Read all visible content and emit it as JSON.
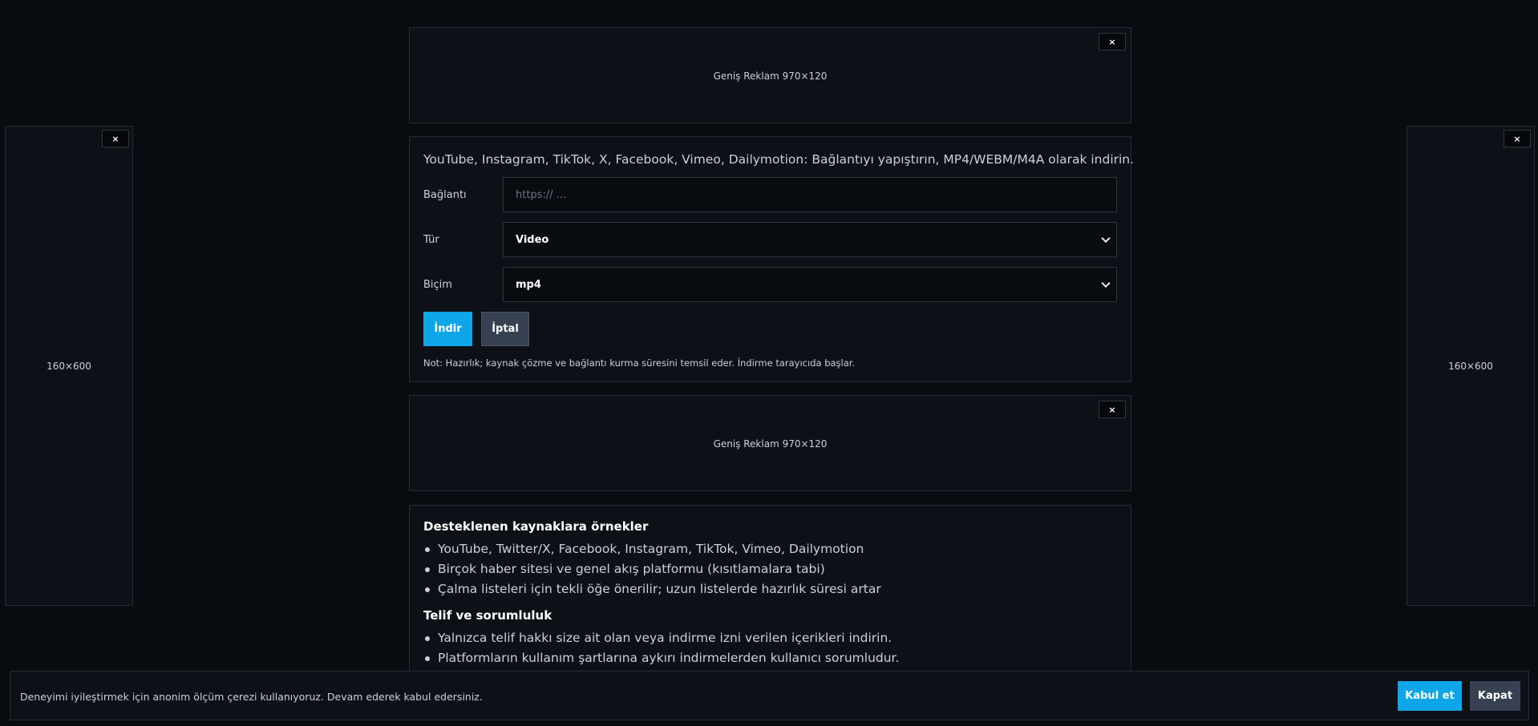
{
  "ads": {
    "side_left_label": "160×600",
    "side_right_label": "160×600",
    "banner_top_label": "Geniş Reklam 970×120",
    "banner_mid_label": "Geniş Reklam 970×120",
    "close_label": "×"
  },
  "form": {
    "headline": "YouTube, Instagram, TikTok, X, Facebook, Vimeo, Dailymotion: Bağlantıyı yapıştırın, MP4/WEBM/M4A olarak indirin.",
    "link_label": "Bağlantı",
    "link_placeholder": "https:// ...",
    "type_label": "Tür",
    "type_value": "Video",
    "format_label": "Biçim",
    "format_value": "mp4",
    "download_button": "İndir",
    "cancel_button": "İptal",
    "note": "Not: Hazırlık; kaynak çözme ve bağlantı kurma süresini temsil eder. İndirme tarayıcıda başlar."
  },
  "info": {
    "supported_title": "Desteklenen kaynaklara örnekler",
    "supported_items": [
      "YouTube, Twitter/X, Facebook, Instagram, TikTok, Vimeo, Dailymotion",
      "Birçok haber sitesi ve genel akış platformu (kısıtlamalara tabi)",
      "Çalma listeleri için tekli öğe önerilir; uzun listelerde hazırlık süresi artar"
    ],
    "copyright_title": "Telif ve sorumluluk",
    "copyright_items": [
      "Yalnızca telif hakkı size ait olan veya indirme izni verilen içerikleri indirin.",
      "Platformların kullanım şartlarına aykırı indirmelerden kullanıcı sorumludur."
    ]
  },
  "cookie": {
    "text": "Deneyimi iyileştirmek için anonim ölçüm çerezi kullanıyoruz. Devam ederek kabul edersiniz.",
    "accept_button": "Kabul et",
    "close_button": "Kapat"
  },
  "colors": {
    "background": "#080b10",
    "panel": "#0d1117",
    "accent": "#0ea5e9",
    "secondary_button": "#374151"
  }
}
